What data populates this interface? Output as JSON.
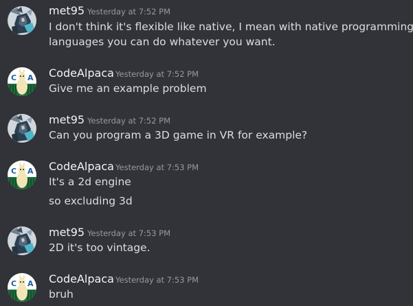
{
  "colors": {
    "background": "#313338",
    "username": "#f2f3f5",
    "timestamp": "#949ba4",
    "message_text": "#dbdee1"
  },
  "messages": [
    {
      "avatar": "met95-avatar",
      "username": "met95",
      "timestamp": "Yesterday at 7:52 PM",
      "lines": [
        "I don't think it's flexible like native, I mean with native programming",
        "languages you can do whatever you want."
      ]
    },
    {
      "avatar": "codealpaca-avatar",
      "username": "CodeAlpaca",
      "timestamp": "Yesterday at 7:52 PM",
      "lines": [
        "Give me an example problem"
      ]
    },
    {
      "avatar": "met95-avatar",
      "username": "met95",
      "timestamp": "Yesterday at 7:52 PM",
      "lines": [
        "Can you program a 3D game in VR for example?"
      ]
    },
    {
      "avatar": "codealpaca-avatar",
      "username": "CodeAlpaca",
      "timestamp": "Yesterday at 7:53 PM",
      "lines": [
        "It's a 2d engine",
        "so excluding 3d"
      ]
    },
    {
      "avatar": "met95-avatar",
      "username": "met95",
      "timestamp": "Yesterday at 7:53 PM",
      "lines": [
        "2D it's too vintage."
      ]
    },
    {
      "avatar": "codealpaca-avatar",
      "username": "CodeAlpaca",
      "timestamp": "Yesterday at 7:53 PM",
      "lines": [
        "bruh"
      ]
    }
  ],
  "avatar_logo": {
    "letters": [
      "C",
      "A"
    ]
  }
}
